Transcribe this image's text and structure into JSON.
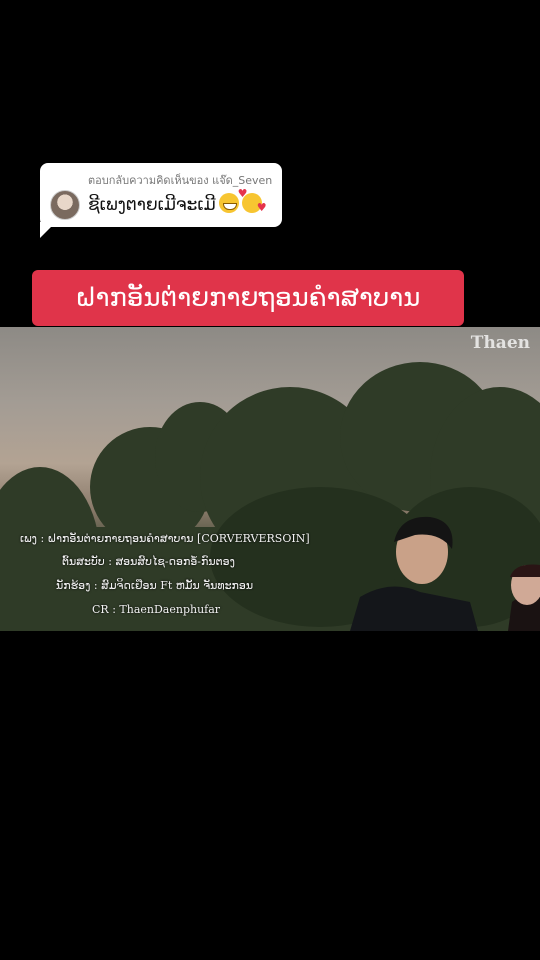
{
  "reply": {
    "header": "ตอบกลับความคิดเห็นของ แจ๊ด_Seven",
    "text": "ຊີເພງຕາຍເມີຈະເມີ",
    "emojis": [
      "grinning-face-icon",
      "smiling-face-with-hearts-icon"
    ]
  },
  "title_banner": {
    "text": "ຝາກອັນຕ່າຍກາຍຖອນຄຳສາບານ",
    "color": "#e0344a"
  },
  "video": {
    "watermark": "Thaen",
    "credits": [
      "ເພງ : ຝາກອັນຕ່າຍກາຍຖອນຄຳສາບານ [CORVERVERSOIN]",
      "ຕົ້ນສະບັບ : ສອນສົບໄຊ-ດອກອໍ້-ກົນຕອງ",
      "ນັກຮ້ອງ : ສົມຈິດເຢືອນ Ft ຫມັ້ນ ຈັນທະກອນ",
      "CR : ThaenDaenphufar"
    ]
  }
}
